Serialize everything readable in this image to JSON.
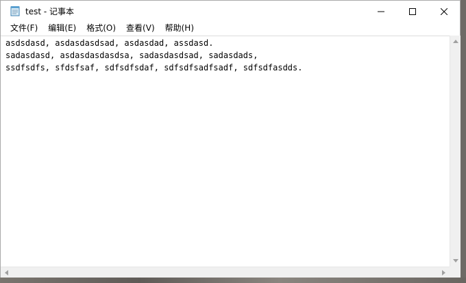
{
  "window": {
    "title": "test - 记事本",
    "accent": "#0078d7"
  },
  "menu": {
    "items": [
      {
        "label": "文件(F)"
      },
      {
        "label": "编辑(E)"
      },
      {
        "label": "格式(O)"
      },
      {
        "label": "查看(V)"
      },
      {
        "label": "帮助(H)"
      }
    ]
  },
  "editor": {
    "lines": [
      "asdsdasd, asdasdasdsad, asdasdad, assdasd.",
      "sadasdasd, asdasdasdasdsa, sadasdasdsad, sadasdads,",
      "ssdfsdfs, sfdsfsaf, sdfsdfsdaf, sdfsdfsadfsadf, sdfsdfasdds."
    ]
  },
  "icons": {
    "app": "notepad-icon",
    "minimize": "minimize-icon",
    "maximize": "maximize-icon",
    "close": "close-icon"
  }
}
